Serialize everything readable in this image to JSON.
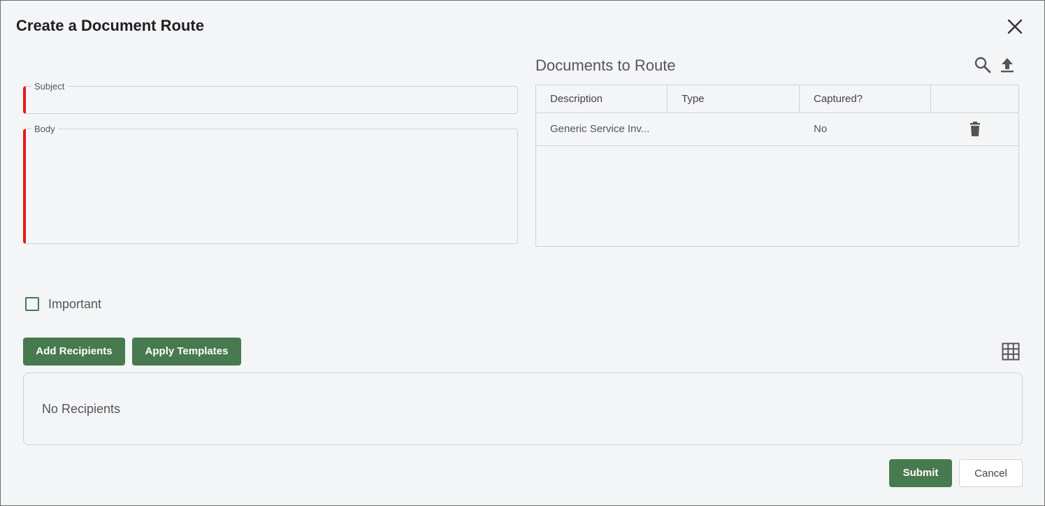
{
  "dialog": {
    "title": "Create a Document Route"
  },
  "form": {
    "subject_label": "Subject",
    "body_label": "Body",
    "subject_value": "",
    "body_value": ""
  },
  "documents": {
    "title": "Documents to Route",
    "columns": [
      "Description",
      "Type",
      "Captured?",
      ""
    ],
    "rows": [
      {
        "description": "Generic Service Inv...",
        "type": "",
        "captured": "No"
      }
    ]
  },
  "important": {
    "label": "Important",
    "checked": false
  },
  "recipients": {
    "add_label": "Add Recipients",
    "apply_label": "Apply Templates",
    "empty_text": "No Recipients"
  },
  "footer": {
    "submit_label": "Submit",
    "cancel_label": "Cancel"
  },
  "colors": {
    "accent_green": "#477a4e",
    "required_red": "#e21b1b",
    "background": "#f4f5f7"
  }
}
